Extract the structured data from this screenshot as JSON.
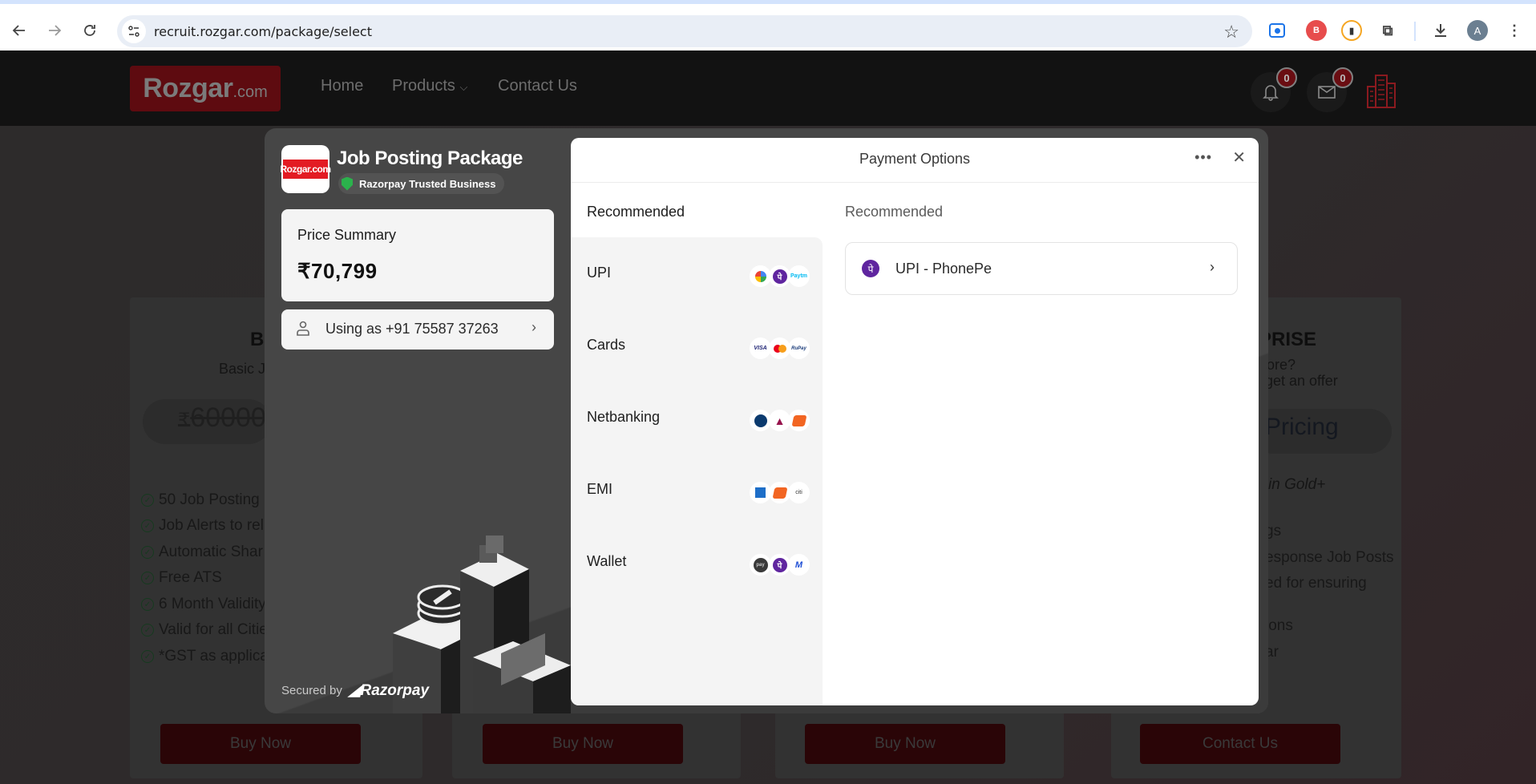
{
  "browser": {
    "url": "recruit.rozgar.com/package/select",
    "profile_initial": "A",
    "extensions": [
      "screen-capture-extension",
      "bonus-extension",
      "camera-extension"
    ]
  },
  "site": {
    "logo_main": "Rozgar",
    "logo_suffix": ".com",
    "nav": [
      "Home",
      "Products",
      "Contact Us"
    ],
    "notifications_count": "0",
    "messages_count": "0"
  },
  "plans": {
    "basic": {
      "title_visible": "BA",
      "subtitle_visible": "Basic J",
      "strike_price": "60000",
      "currency": "₹",
      "features": [
        "50 Job Posting",
        "Job Alerts to rel",
        "Automatic Shar",
        "Free ATS",
        "6 Month Validity",
        "Valid for all Citie",
        "*GST as applica"
      ],
      "button": "Buy Now"
    },
    "plan2": {
      "button": "Buy Now"
    },
    "plan3": {
      "button": "Buy Now"
    },
    "enterprise": {
      "title_visible": "PRISE",
      "subtitle_line1": "ore?",
      "subtitle_line2": "get an offer",
      "price_visible": "Pricing",
      "note": "in Gold+",
      "features": [
        "gs",
        "esponse Job Posts",
        "ed for ensuring",
        "ions",
        "ar"
      ],
      "button": "Contact Us"
    }
  },
  "checkout": {
    "merchant_logo_text": "Rozgar.com",
    "merchant_name": "Job Posting Package",
    "trusted_label": "Razorpay Trusted Business",
    "price_summary_label": "Price Summary",
    "price_amount": "₹70,799",
    "user_label": "Using as +91 75587 37263",
    "secured_by": "Secured by",
    "secured_brand": "Razorpay",
    "title": "Payment Options",
    "left_section_label": "Recommended",
    "right_section_label": "Recommended",
    "methods": [
      {
        "label": "UPI",
        "logos": [
          "Google Pay",
          "PhonePe",
          "Paytm"
        ]
      },
      {
        "label": "Cards",
        "logos": [
          "Visa",
          "Mastercard",
          "RuPay"
        ]
      },
      {
        "label": "Netbanking",
        "logos": [
          "ICICI",
          "Axis",
          "Bank of Baroda"
        ]
      },
      {
        "label": "EMI",
        "logos": [
          "HDFC",
          "Bank of Baroda",
          "Citi"
        ]
      },
      {
        "label": "Wallet",
        "logos": [
          "Amazon Pay",
          "PhonePe",
          "Mobikwik"
        ]
      }
    ],
    "recommended_item": "UPI - PhonePe"
  }
}
